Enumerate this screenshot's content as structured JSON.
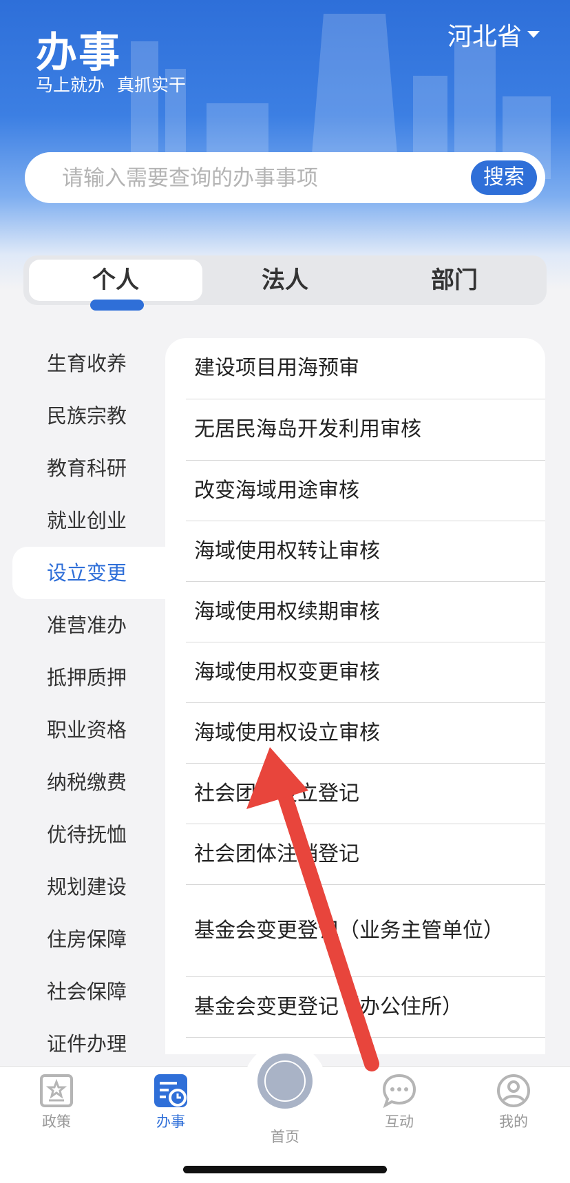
{
  "header": {
    "title": "办事",
    "slogan": [
      "马上就办",
      "真抓实干"
    ],
    "region": "河北省"
  },
  "search": {
    "placeholder": "请输入需要查询的办事事项",
    "button": "搜索"
  },
  "tabs": [
    "个人",
    "法人",
    "部门"
  ],
  "active_tab": "个人",
  "sidebar": [
    "生育收养",
    "民族宗教",
    "教育科研",
    "就业创业",
    "设立变更",
    "准营准办",
    "抵押质押",
    "职业资格",
    "纳税缴费",
    "优待抚恤",
    "规划建设",
    "住房保障",
    "社会保障",
    "证件办理"
  ],
  "sidebar_active": "设立变更",
  "items": [
    "建设项目用海预审",
    "无居民海岛开发利用审核",
    "改变海域用途审核",
    "海域使用权转让审核",
    "海域使用权续期审核",
    "海域使用权变更审核",
    "海域使用权设立审核",
    "社会团体设立登记",
    "社会团体注销登记",
    "基金会变更登记（业务主管单位）",
    "基金会变更登记（办公住所）"
  ],
  "tabbar": [
    "政策",
    "办事",
    "首页",
    "互动",
    "我的"
  ],
  "tabbar_active": "办事",
  "colors": {
    "accent": "#2f6fd8",
    "annotation_arrow": "#e8453c"
  }
}
